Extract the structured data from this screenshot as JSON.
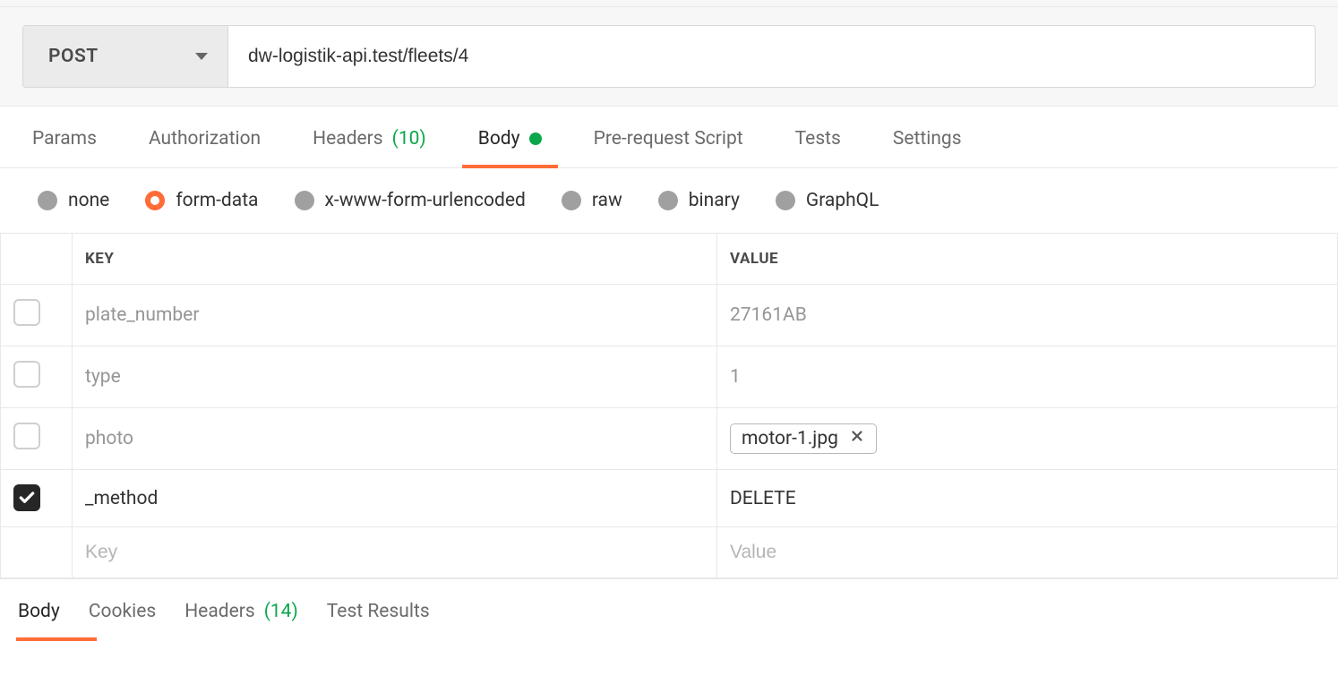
{
  "request": {
    "method": "POST",
    "url": "dw-logistik-api.test/fleets/4"
  },
  "tabs": {
    "params": "Params",
    "authorization": "Authorization",
    "headers_label": "Headers",
    "headers_count": "(10)",
    "body": "Body",
    "prerequest": "Pre-request Script",
    "tests": "Tests",
    "settings": "Settings"
  },
  "body_types": {
    "none": "none",
    "formdata": "form-data",
    "urlencoded": "x-www-form-urlencoded",
    "raw": "raw",
    "binary": "binary",
    "graphql": "GraphQL"
  },
  "table": {
    "key_header": "KEY",
    "value_header": "VALUE",
    "rows": [
      {
        "checked": false,
        "key": "plate_number",
        "value": "27161AB",
        "type": "text"
      },
      {
        "checked": false,
        "key": "type",
        "value": "1",
        "type": "text"
      },
      {
        "checked": false,
        "key": "photo",
        "value": "motor-1.jpg",
        "type": "file"
      },
      {
        "checked": true,
        "key": "_method",
        "value": "DELETE",
        "type": "text"
      }
    ],
    "placeholder_key": "Key",
    "placeholder_value": "Value"
  },
  "response_tabs": {
    "body": "Body",
    "cookies": "Cookies",
    "headers_label": "Headers",
    "headers_count": "(14)",
    "test_results": "Test Results"
  }
}
